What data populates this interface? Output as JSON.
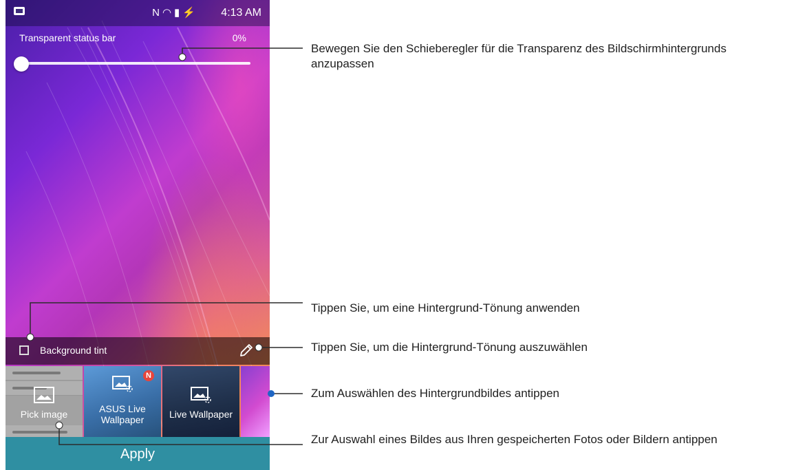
{
  "status_bar": {
    "icons": [
      "notification-icon",
      "nfc-icon",
      "wifi-icon",
      "sd-card-icon",
      "battery-charging-icon"
    ],
    "time": "4:13 AM"
  },
  "slider": {
    "label": "Transparent status bar",
    "value_text": "0%",
    "value": 0
  },
  "tint": {
    "label": "Background tint",
    "checked": false
  },
  "thumbnails": [
    {
      "label": "Pick image",
      "icon": "image-icon"
    },
    {
      "label": "ASUS Live Wallpaper",
      "label_line1": "ASUS Live",
      "label_line2": "Wallpaper",
      "badge": "N",
      "icon": "live-wallpaper-icon"
    },
    {
      "label": "Live Wallpaper",
      "icon": "live-wallpaper-icon"
    },
    {
      "label": "",
      "icon": ""
    }
  ],
  "apply_label": "Apply",
  "callouts": [
    {
      "text": "Bewegen Sie den Schieberegler für die Transparenz des Bildschirmhintergrunds anzupassen"
    },
    {
      "text": "Tippen Sie, um eine Hintergrund-Tönung anwenden"
    },
    {
      "text": "Tippen Sie, um die Hintergrund-Tönung auszuwählen"
    },
    {
      "text": "Zum Auswählen des Hintergrundbildes antippen"
    },
    {
      "text": "Zur Auswahl eines Bildes aus Ihren gespeicherten Fotos oder Bildern antippen"
    }
  ],
  "colors": {
    "apply_bar": "#2f8fa2",
    "callout_line": "#2c2c2c",
    "accent_dot": "#1f66c4"
  }
}
